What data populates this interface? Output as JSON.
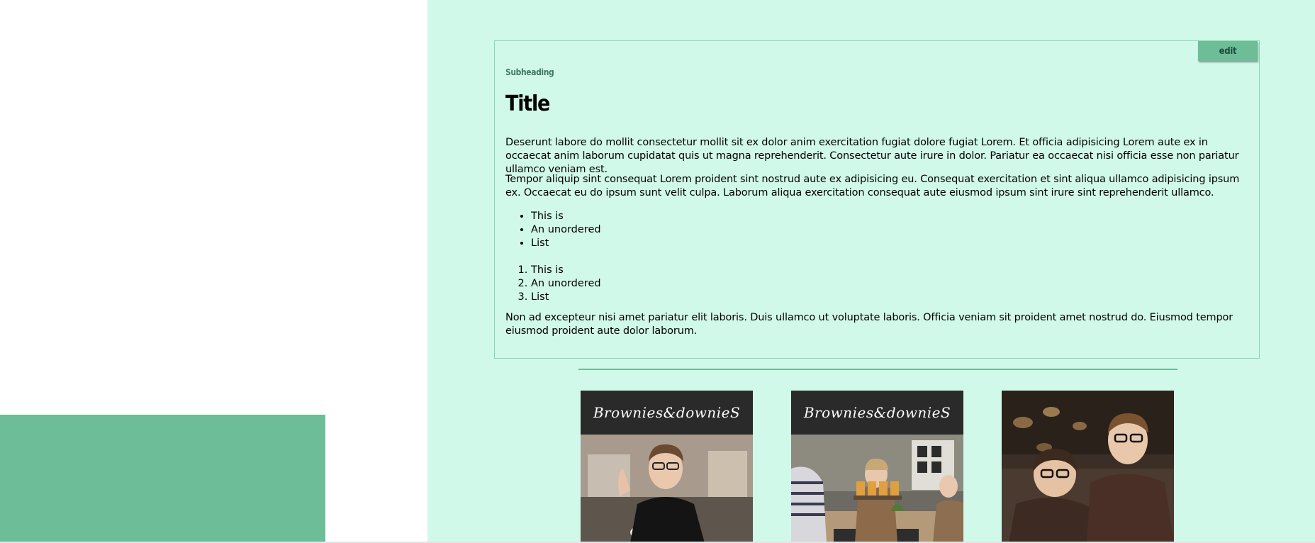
{
  "card": {
    "edit_label": "edit",
    "subheading": "Subheading",
    "title": "Title",
    "paragraphs": [
      "Deserunt labore do mollit consectetur mollit sit ex dolor anim exercitation fugiat dolore fugiat Lorem. Et officia adipisicing Lorem aute ex in occaecat anim laborum cupidatat quis ut magna reprehenderit. Consectetur aute irure in dolor. Pariatur ea occaecat nisi officia esse non pariatur ullamco veniam est.",
      "Tempor aliquip sint consequat Lorem proident sint nostrud aute ex adipisicing eu. Consequat exercitation et sint aliqua ullamco adipisicing ipsum ex. Occaecat eu do ipsum sunt velit culpa. Laborum aliqua exercitation consequat aute eiusmod ipsum sint irure sint reprehenderit ullamco.",
      "Non ad excepteur nisi amet pariatur elit laboris. Duis ullamco ut voluptate laboris. Officia veniam sit proident amet nostrud do. Eiusmod tempor eiusmod proident aute dolor laborum."
    ],
    "unordered_list": [
      "This is",
      "An unordered",
      "List"
    ],
    "ordered_list": [
      "This is",
      "An unordered",
      "List"
    ]
  },
  "gallery": {
    "banner_text": "Brownies&downieS"
  },
  "colors": {
    "panel_background": "#d1f9e9",
    "accent_green": "#6ebd99",
    "card_border": "#8ed3b4",
    "subheading_text": "#3e7a62"
  }
}
